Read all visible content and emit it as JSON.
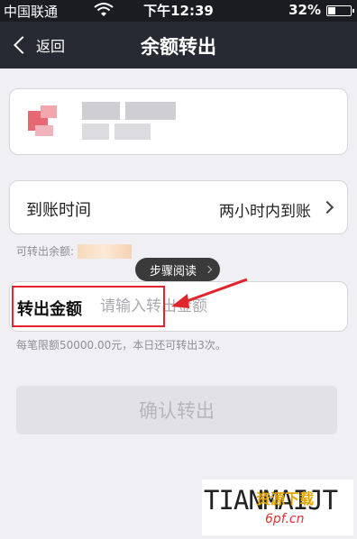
{
  "status_bar": {
    "carrier": "中国联通",
    "time": "下午12:39",
    "battery": "32%"
  },
  "nav": {
    "back_label": "返回",
    "title": "余额转出"
  },
  "arrival": {
    "label": "到账时间",
    "value": "两小时内到账"
  },
  "available": {
    "label": "可转出余额:"
  },
  "tooltip": {
    "label": "步骤阅读"
  },
  "amount": {
    "label": "转出金额",
    "placeholder": "请输入转出金额",
    "value": ""
  },
  "limit_note": "每笔限额50000.00元，本日还可转出3次。",
  "confirm_label": "确认转出",
  "watermark": {
    "brand": "TIANMAIJT",
    "cn": "资源下载",
    "site": "6pf.cn"
  },
  "colors": {
    "nav_bg": "#282a33",
    "highlight": "#e0262c"
  }
}
